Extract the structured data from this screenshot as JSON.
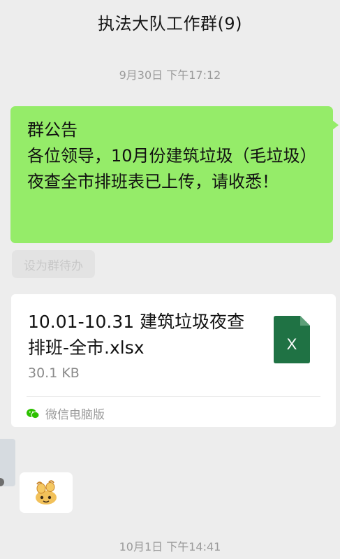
{
  "header": {
    "title": "执法大队工作群(9)"
  },
  "messages": {
    "timestamp_1": "9月30日 下午17:12",
    "announcement": {
      "heading": "群公告",
      "body": "各位领导，10月份建筑垃圾（毛垃圾）夜查全市排班表已上传，请收悉！",
      "bubble_color": "#95ec69"
    },
    "todo_chip_label": "设为群待办",
    "file": {
      "name": "10.01-10.31 建筑垃圾夜查排班-全市.xlsx",
      "size": "30.1 KB",
      "icon": "excel-file-icon",
      "icon_letter": "X",
      "icon_color": "#1f7244",
      "source_label": "微信电脑版",
      "source_icon": "wechat-icon"
    },
    "sticker": {
      "icon": "cartoon-sticker"
    },
    "timestamp_2": "10月1日 下午14:41"
  }
}
